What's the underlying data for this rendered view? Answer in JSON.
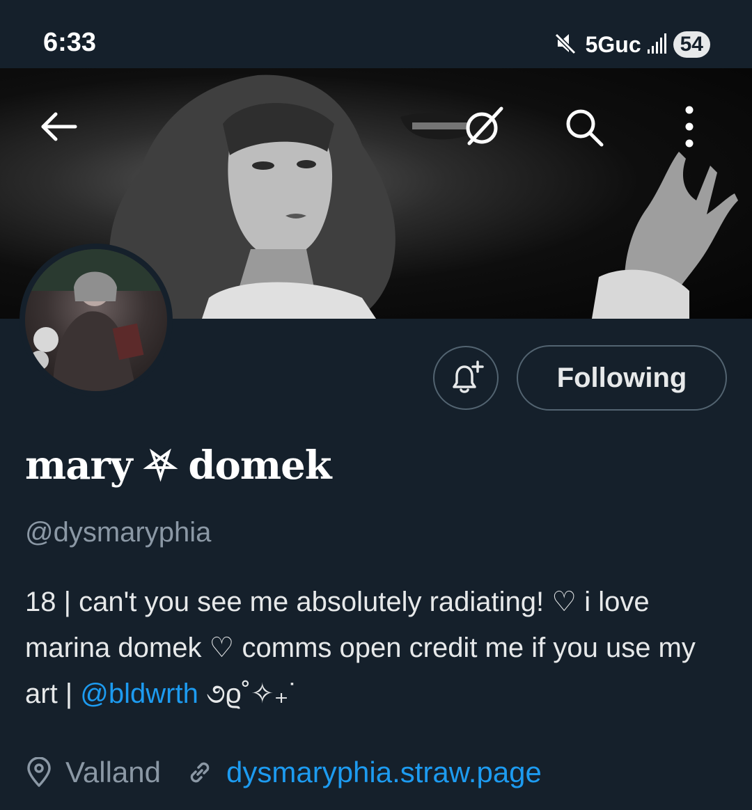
{
  "status_bar": {
    "time": "6:33",
    "network": "5Guc",
    "battery": "54",
    "icons": [
      "mute-icon",
      "signal-icon"
    ]
  },
  "header": {
    "icons": [
      "back-arrow-icon",
      "grok-icon",
      "search-icon",
      "more-icon"
    ]
  },
  "profile": {
    "display_name": "mary ⛧ domek",
    "handle": "@dysmaryphia",
    "bio_text": "18 | can't you see me absolutely radiating! ♡ i love marina domek ♡ comms open credit me if you use my art | ",
    "bio_mention": "@bldwrth",
    "bio_suffix": " ૭ϱ˚✧₊˙",
    "location": "Valland",
    "website": "dysmaryphia.straw.page"
  },
  "actions": {
    "following_label": "Following",
    "notify_icon": "bell-plus-icon"
  },
  "colors": {
    "background": "#15202b",
    "accent": "#1d9bf0",
    "secondary_text": "#8b98a5",
    "border": "#536471"
  }
}
